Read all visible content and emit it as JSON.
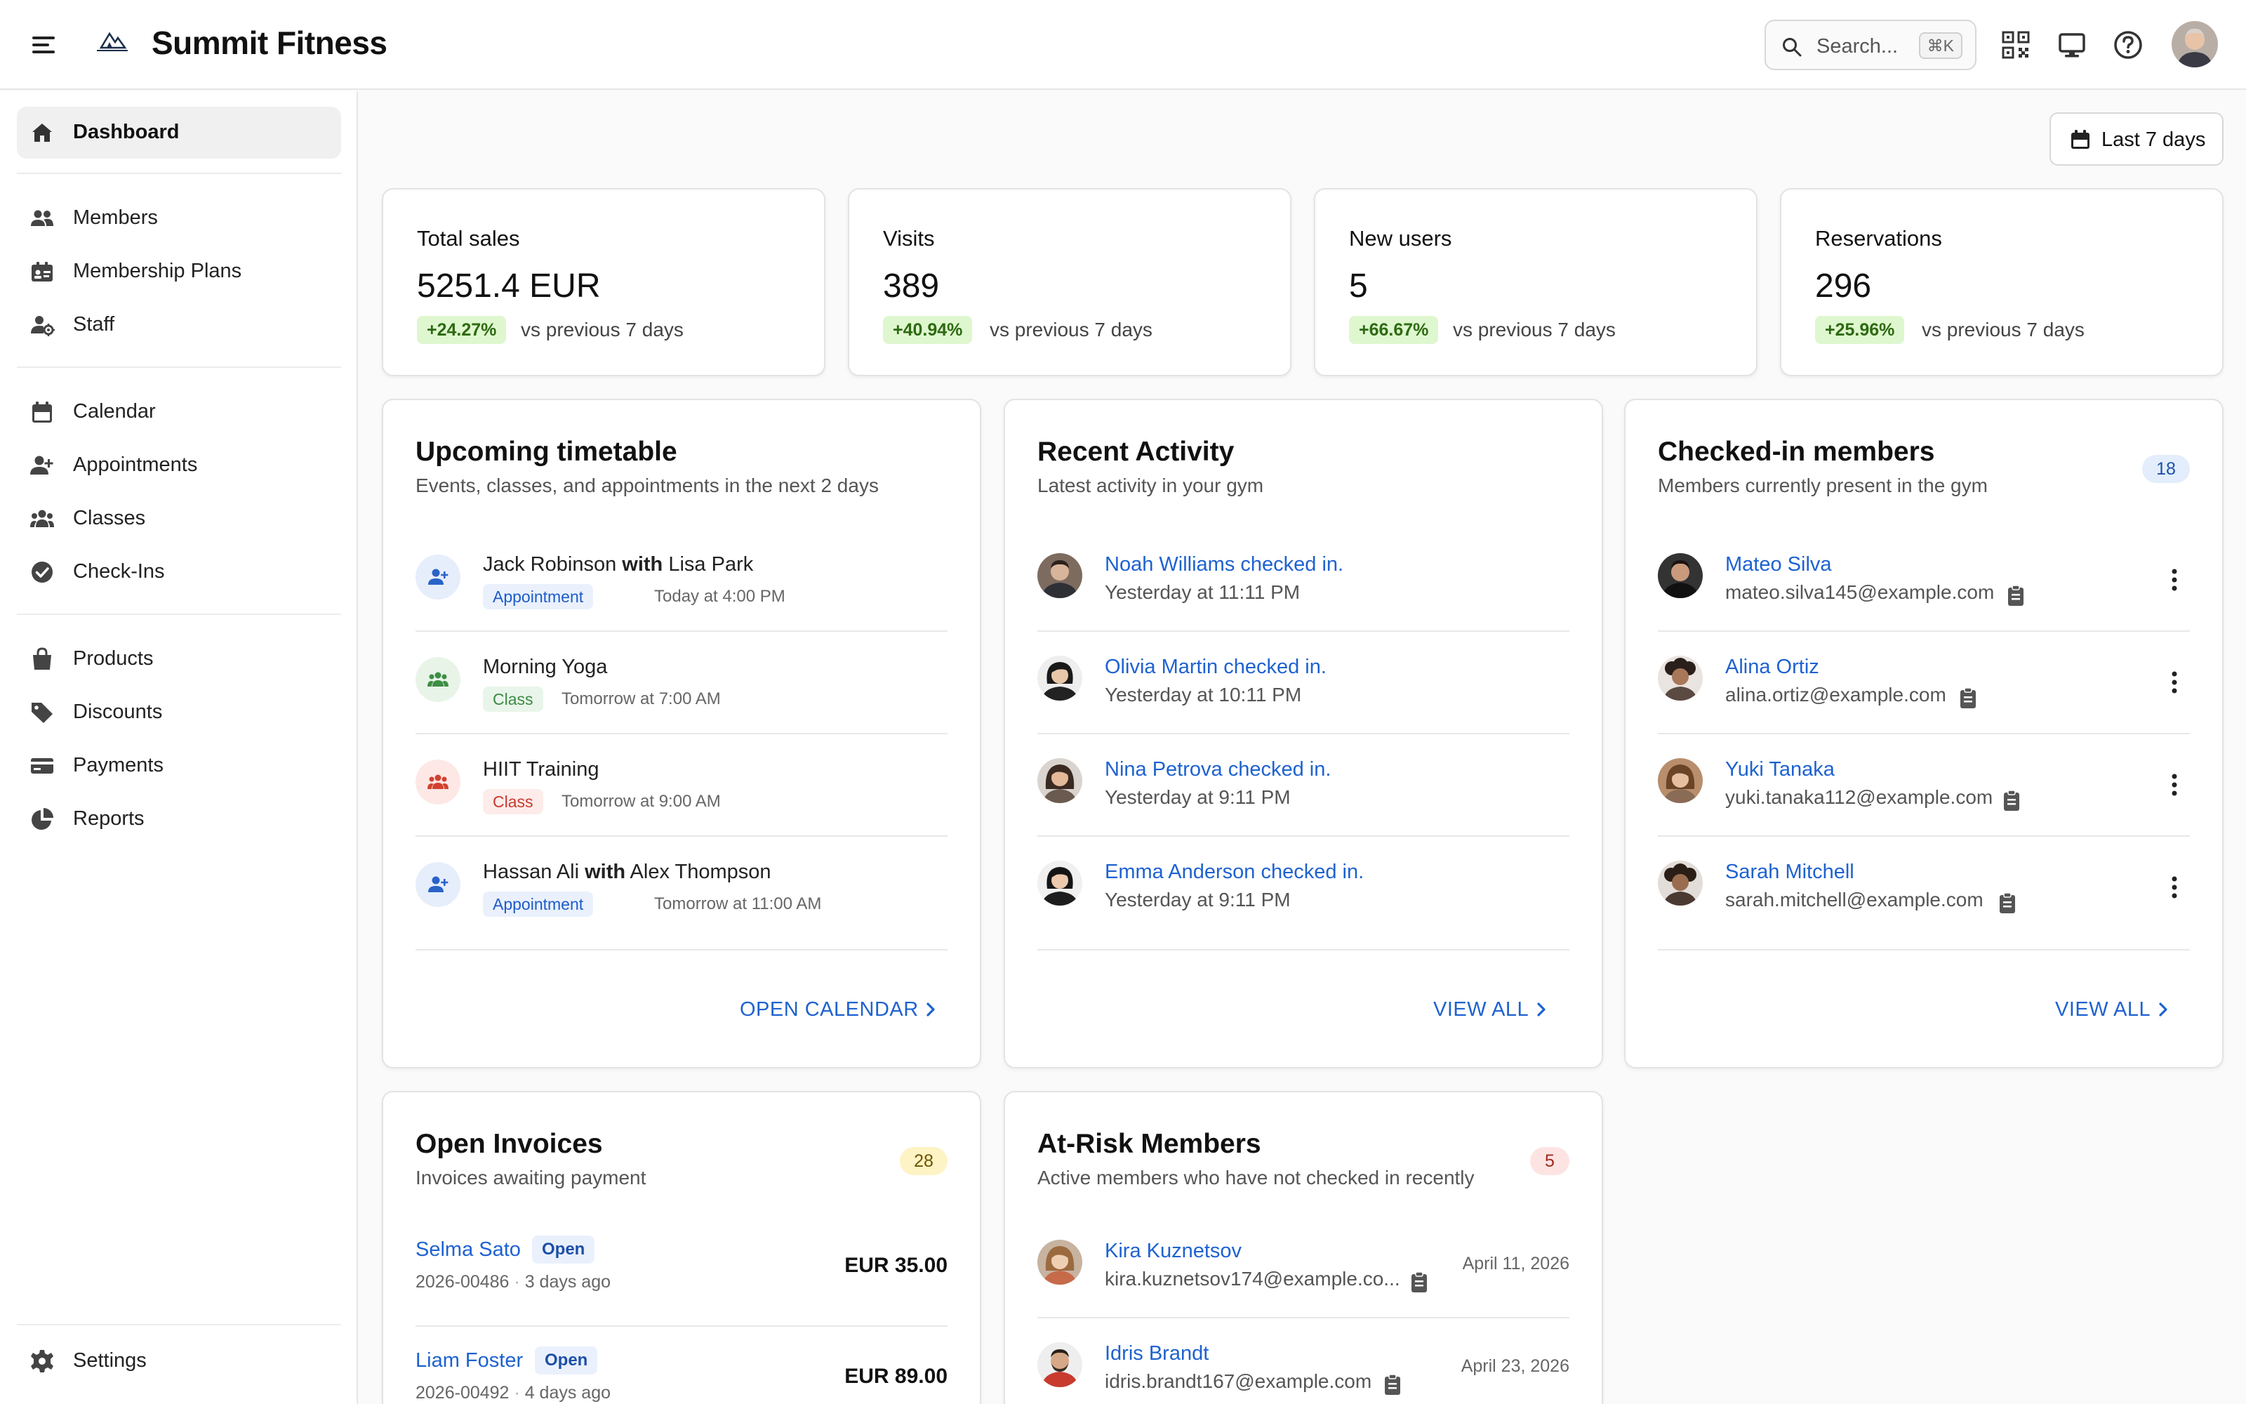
{
  "header": {
    "title": "Summit Fitness",
    "search_placeholder": "Search...",
    "search_shortcut": "⌘K"
  },
  "sidebar": {
    "dashboard": "Dashboard",
    "members": "Members",
    "membership_plans": "Membership Plans",
    "staff": "Staff",
    "calendar": "Calendar",
    "appointments": "Appointments",
    "classes": "Classes",
    "check_ins": "Check-Ins",
    "products": "Products",
    "discounts": "Discounts",
    "payments": "Payments",
    "reports": "Reports",
    "settings": "Settings"
  },
  "range": {
    "label": "Last 7 days"
  },
  "stats": [
    {
      "label": "Total sales",
      "value": "5251.4 EUR",
      "change": "+24.27%",
      "compare": "vs previous 7 days"
    },
    {
      "label": "Visits",
      "value": "389",
      "change": "+40.94%",
      "compare": "vs previous 7 days"
    },
    {
      "label": "New users",
      "value": "5",
      "change": "+66.67%",
      "compare": "vs previous 7 days"
    },
    {
      "label": "Reservations",
      "value": "296",
      "change": "+25.96%",
      "compare": "vs previous 7 days"
    }
  ],
  "timetable": {
    "title": "Upcoming timetable",
    "subtitle": "Events, classes, and appointments in the next 2 days",
    "items": [
      {
        "name": "Jack Robinson",
        "with": "with",
        "partner": "Lisa Park",
        "tag": "Appointment",
        "time": "Today at 4:00 PM"
      },
      {
        "name": "Morning Yoga",
        "tag": "Class",
        "time": "Tomorrow at 7:00 AM"
      },
      {
        "name": "HIIT Training",
        "tag": "Class",
        "time": "Tomorrow at 9:00 AM"
      },
      {
        "name": "Hassan Ali",
        "with": "with",
        "partner": "Alex Thompson",
        "tag": "Appointment",
        "time": "Tomorrow at 11:00 AM"
      }
    ],
    "link": "OPEN CALENDAR"
  },
  "activity": {
    "title": "Recent Activity",
    "subtitle": "Latest activity in your gym",
    "items": [
      {
        "text": "Noah Williams checked in.",
        "time": "Yesterday at 11:11 PM"
      },
      {
        "text": "Olivia Martin checked in.",
        "time": "Yesterday at 10:11 PM"
      },
      {
        "text": "Nina Petrova checked in.",
        "time": "Yesterday at 9:11 PM"
      },
      {
        "text": "Emma Anderson checked in.",
        "time": "Yesterday at 9:11 PM"
      }
    ],
    "link": "VIEW ALL"
  },
  "checked_in": {
    "title": "Checked-in members",
    "subtitle": "Members currently present in the gym",
    "count": "18",
    "items": [
      {
        "name": "Mateo Silva",
        "email": "mateo.silva145@example.com"
      },
      {
        "name": "Alina Ortiz",
        "email": "alina.ortiz@example.com"
      },
      {
        "name": "Yuki Tanaka",
        "email": "yuki.tanaka112@example.com"
      },
      {
        "name": "Sarah Mitchell",
        "email": "sarah.mitchell@example.com"
      }
    ],
    "link": "VIEW ALL"
  },
  "invoices": {
    "title": "Open Invoices",
    "subtitle": "Invoices awaiting payment",
    "count": "28",
    "items": [
      {
        "name": "Selma Sato",
        "status": "Open",
        "number": "2026-00486",
        "sep": "·",
        "age": "3 days ago",
        "amount": "EUR 35.00"
      },
      {
        "name": "Liam Foster",
        "status": "Open",
        "number": "2026-00492",
        "sep": "·",
        "age": "4 days ago",
        "amount": "EUR 89.00"
      }
    ]
  },
  "at_risk": {
    "title": "At-Risk Members",
    "subtitle": "Active members who have not checked in recently",
    "count": "5",
    "items": [
      {
        "name": "Kira Kuznetsov",
        "email": "kira.kuznetsov174@example.co...",
        "date": "April 11, 2026"
      },
      {
        "name": "Idris Brandt",
        "email": "idris.brandt167@example.com",
        "date": "April 23, 2026"
      }
    ]
  },
  "colors": {
    "link_blue": "#1e62d0",
    "badge_green_bg": "#dff7cf",
    "badge_green_text": "#2d6a12"
  }
}
